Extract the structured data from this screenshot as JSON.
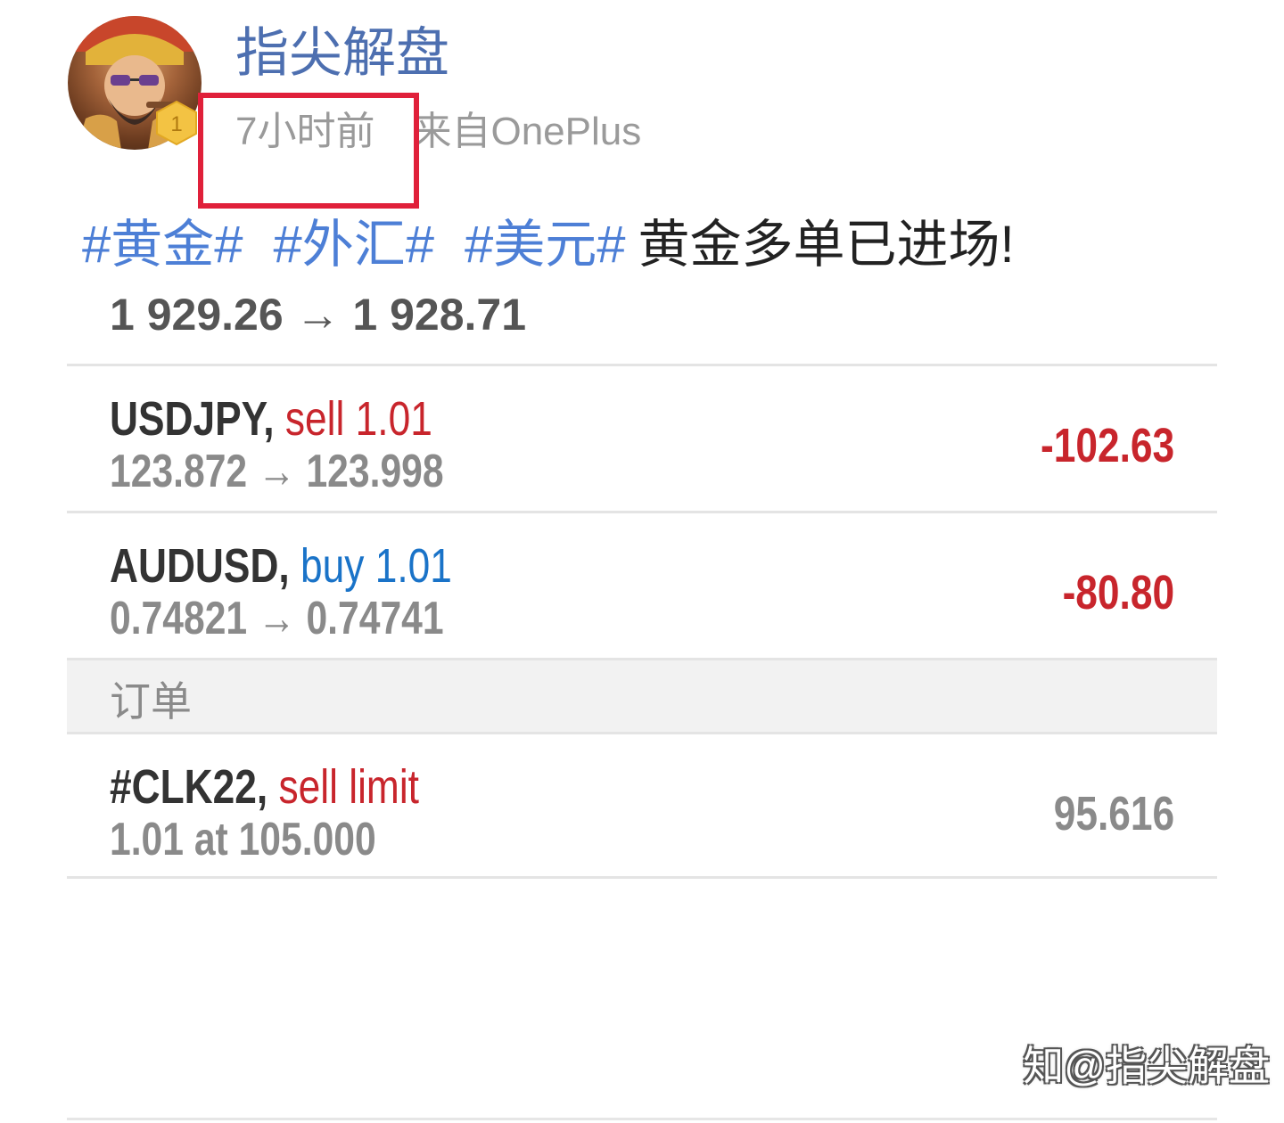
{
  "post": {
    "author": "指尖解盘",
    "badge_level": "1",
    "time": "7小时前",
    "source": "来自OnePlus",
    "tags": [
      "#黄金#",
      "#外汇#",
      "#美元#"
    ],
    "text": "黄金多单已进场!"
  },
  "trades": {
    "cut_row_text": "1 929.26 → 1 928.71",
    "positions": [
      {
        "symbol": "USDJPY,",
        "side": "sell 1.01",
        "side_type": "sell",
        "prices": "123.872 → 123.998",
        "profit": "-102.63"
      },
      {
        "symbol": "AUDUSD,",
        "side": "buy 1.01",
        "side_type": "buy",
        "prices": "0.74821 → 0.74741",
        "profit": "-80.80"
      }
    ],
    "orders_header": "订单",
    "orders": [
      {
        "symbol": "#CLK22,",
        "side": "sell limit",
        "side_type": "sell",
        "details": "1.01 at 105.000",
        "price": "95.616"
      }
    ]
  },
  "watermark": "知@指尖解盘",
  "colors": {
    "author_blue": "#4d6fb0",
    "tag_blue": "#4d7fd6",
    "sell_red": "#c8252c",
    "buy_blue": "#1a73c8",
    "highlight_red": "#e0203a",
    "meta_gray": "#9a9a9a"
  },
  "icons": {
    "avatar": "user-avatar-illustration",
    "badge": "level-hexagon-badge",
    "watermark_logo": "zhihu-logo"
  }
}
